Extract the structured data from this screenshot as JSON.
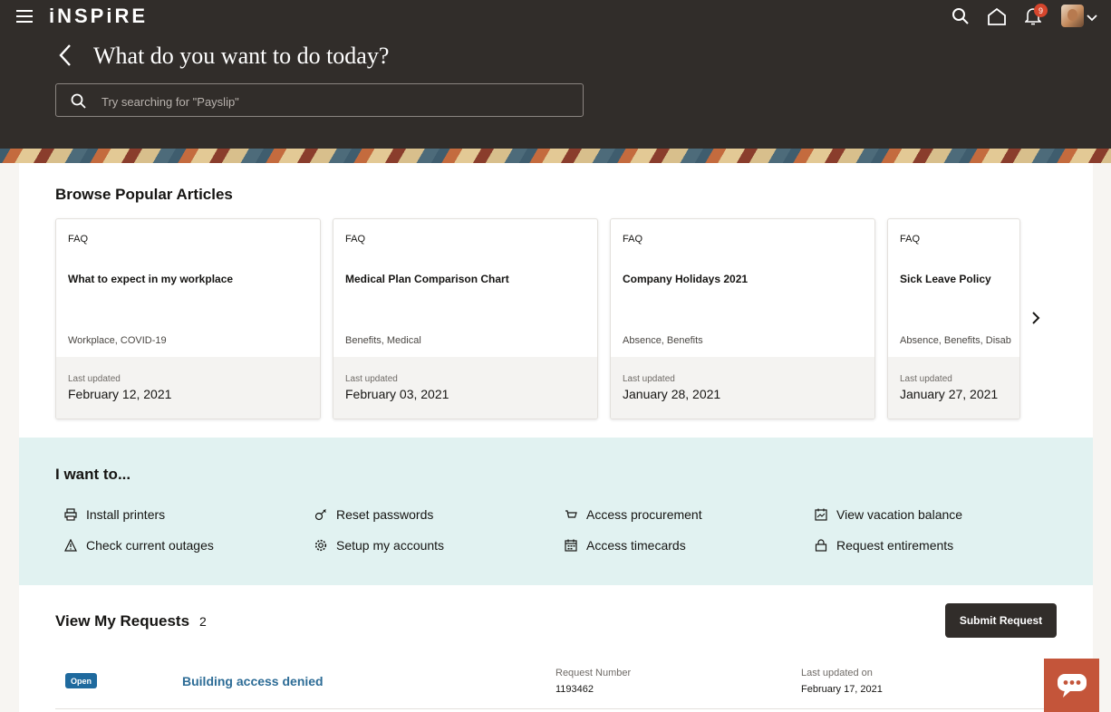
{
  "app": {
    "logo": "iNSPiRE"
  },
  "header": {
    "notification_count": "9",
    "page_title": "What do you want to do today?",
    "search": {
      "placeholder": "Try searching for \"Payslip\""
    }
  },
  "articles": {
    "title": "Browse Popular Articles",
    "items": [
      {
        "type": "FAQ",
        "title": "What to expect in my workplace",
        "tags": "Workplace, COVID-19",
        "updated_label": "Last updated",
        "date": "February 12, 2021"
      },
      {
        "type": "FAQ",
        "title": "Medical Plan Comparison Chart",
        "tags": "Benefits, Medical",
        "updated_label": "Last updated",
        "date": "February 03, 2021"
      },
      {
        "type": "FAQ",
        "title": "Company Holidays 2021",
        "tags": "Absence, Benefits",
        "updated_label": "Last updated",
        "date": "January 28, 2021"
      },
      {
        "type": "FAQ",
        "title": "Sick Leave Policy",
        "tags": "Absence, Benefits, Disab",
        "updated_label": "Last updated",
        "date": "January 27, 2021"
      }
    ]
  },
  "iwant": {
    "title": "I want to...",
    "actions": [
      {
        "label": "Install printers",
        "icon": "printer-icon"
      },
      {
        "label": "Reset passwords",
        "icon": "key-icon"
      },
      {
        "label": "Access procurement",
        "icon": "cart-icon"
      },
      {
        "label": "View vacation balance",
        "icon": "calendar-chart-icon"
      },
      {
        "label": "Check current outages",
        "icon": "warning-icon"
      },
      {
        "label": "Setup my accounts",
        "icon": "gear-icon"
      },
      {
        "label": "Access timecards",
        "icon": "calendar-icon"
      },
      {
        "label": "Request entirements",
        "icon": "lock-icon"
      }
    ]
  },
  "requests": {
    "title": "View My Requests",
    "count": "2",
    "submit_label": "Submit Request",
    "items": [
      {
        "status": "Open",
        "title": "Building access denied",
        "number_label": "Request Number",
        "number": "1193462",
        "updated_label": "Last updated on",
        "updated": "February 17, 2021"
      }
    ]
  },
  "colors": {
    "header_bg": "#312d2a",
    "accent_teal": "#e1f2f1",
    "link": "#2d6c96",
    "chat": "#c4553a",
    "badge": "#d6462d"
  }
}
